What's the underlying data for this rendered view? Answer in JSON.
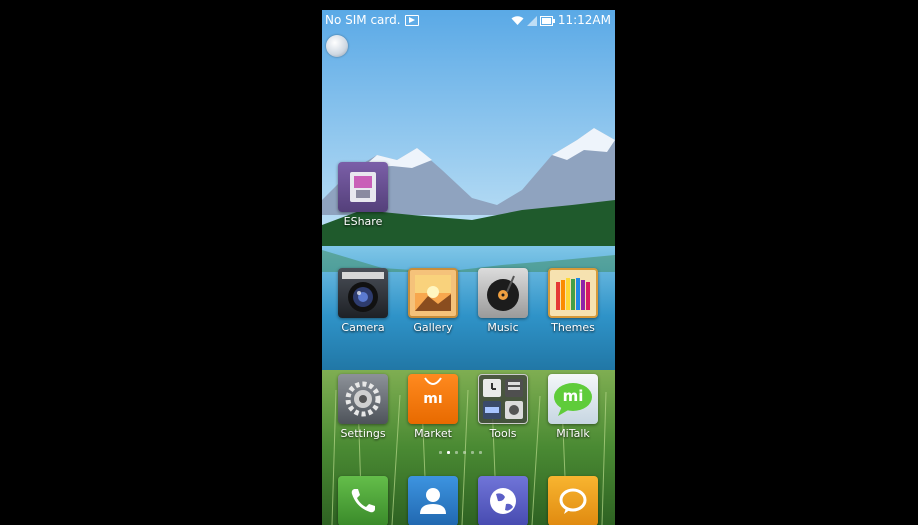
{
  "statusbar": {
    "carrier": "No SIM card.",
    "time": "11:12AM"
  },
  "homescreen": {
    "top_apps": [
      {
        "label": "EShare",
        "icon": "eshare-icon"
      }
    ],
    "row1": [
      {
        "label": "Camera",
        "icon": "camera-icon"
      },
      {
        "label": "Gallery",
        "icon": "gallery-icon"
      },
      {
        "label": "Music",
        "icon": "music-icon"
      },
      {
        "label": "Themes",
        "icon": "themes-icon"
      }
    ],
    "row2": [
      {
        "label": "Settings",
        "icon": "gear-icon"
      },
      {
        "label": "Market",
        "icon": "mi-shopping-bag-icon",
        "icon_text": "mı"
      },
      {
        "label": "Tools",
        "icon": "tools-folder-icon"
      },
      {
        "label": "MiTalk",
        "icon": "mitalk-bubble-icon",
        "icon_text": "mi"
      }
    ],
    "page_indicator": {
      "pages": 6,
      "current": 2
    },
    "dock": [
      {
        "icon": "phone-icon",
        "color": "#4ea53a"
      },
      {
        "icon": "contacts-icon",
        "color": "#2c7fd0"
      },
      {
        "icon": "browser-globe-icon",
        "color": "#5b5fc7"
      },
      {
        "icon": "messaging-icon",
        "color": "#f0a020"
      }
    ]
  }
}
